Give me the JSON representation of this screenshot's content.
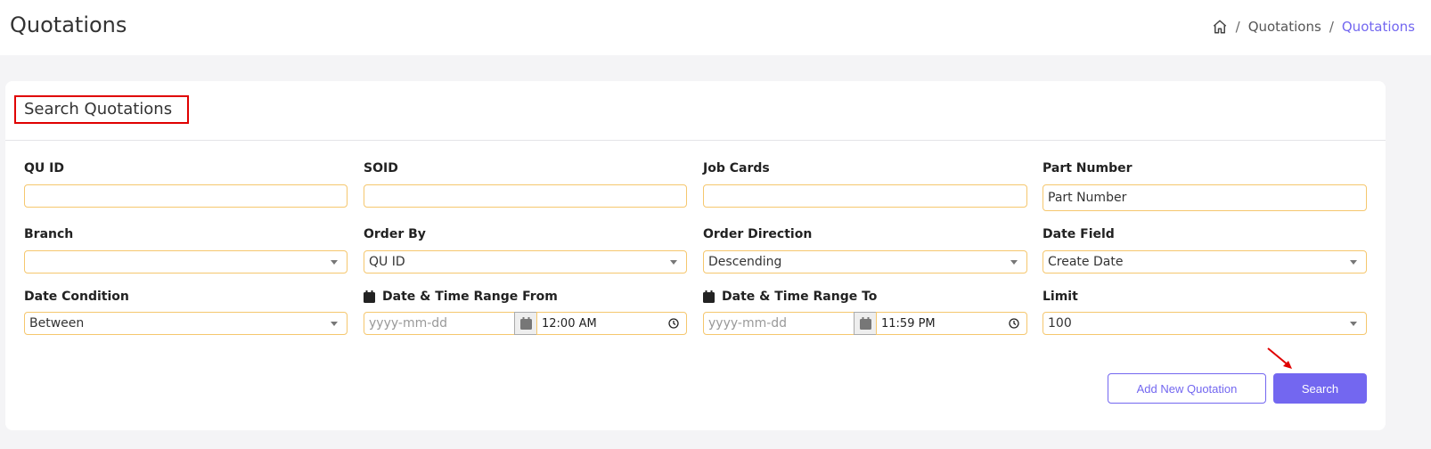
{
  "header": {
    "title": "Quotations",
    "breadcrumb": {
      "home_icon": "home-icon",
      "items": [
        "Quotations",
        "Quotations"
      ],
      "separator": "/"
    }
  },
  "card": {
    "title": "Search Quotations"
  },
  "fields": {
    "qu_id": {
      "label": "QU ID",
      "value": ""
    },
    "soid": {
      "label": "SOID",
      "value": ""
    },
    "job_cards": {
      "label": "Job Cards",
      "value": ""
    },
    "part_number": {
      "label": "Part Number",
      "value": "",
      "placeholder": "Part Number"
    },
    "branch": {
      "label": "Branch",
      "value": ""
    },
    "order_by": {
      "label": "Order By",
      "value": "QU ID"
    },
    "order_direction": {
      "label": "Order Direction",
      "value": "Descending"
    },
    "date_field": {
      "label": "Date Field",
      "value": "Create Date"
    },
    "date_condition": {
      "label": "Date Condition",
      "value": "Between"
    },
    "range_from": {
      "label": "Date & Time Range From",
      "date_placeholder": "yyyy-mm-dd",
      "time": "12:00 AM"
    },
    "range_to": {
      "label": "Date & Time Range To",
      "date_placeholder": "yyyy-mm-dd",
      "time": "11:59 PM"
    },
    "limit": {
      "label": "Limit",
      "value": "100"
    }
  },
  "actions": {
    "add_new": "Add New Quotation",
    "search": "Search"
  },
  "colors": {
    "accent": "#7367f0",
    "field_border": "#f5c76e",
    "highlight_box": "#e00000",
    "annotation_arrow": "#e00000"
  }
}
